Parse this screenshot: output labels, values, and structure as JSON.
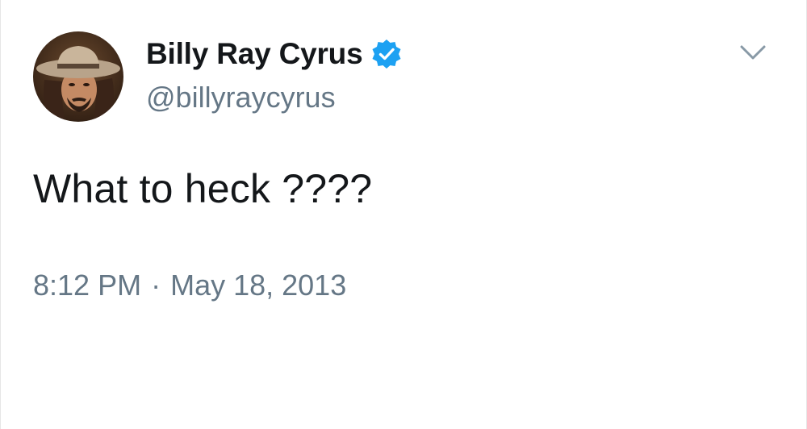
{
  "user": {
    "display_name": "Billy Ray Cyrus",
    "handle": "@billyraycyrus",
    "verified": true,
    "avatar_icon": "profile-photo-cowboy-hat"
  },
  "tweet": {
    "text": "What to heck ????",
    "time": "8:12 PM",
    "separator": "·",
    "date": "May 18, 2013"
  },
  "icons": {
    "verified": "verified-badge-icon",
    "menu": "chevron-down-icon"
  },
  "colors": {
    "name": "#14171a",
    "secondary": "#657786",
    "verified_blue": "#1da1f2",
    "caret": "#8899a6"
  }
}
